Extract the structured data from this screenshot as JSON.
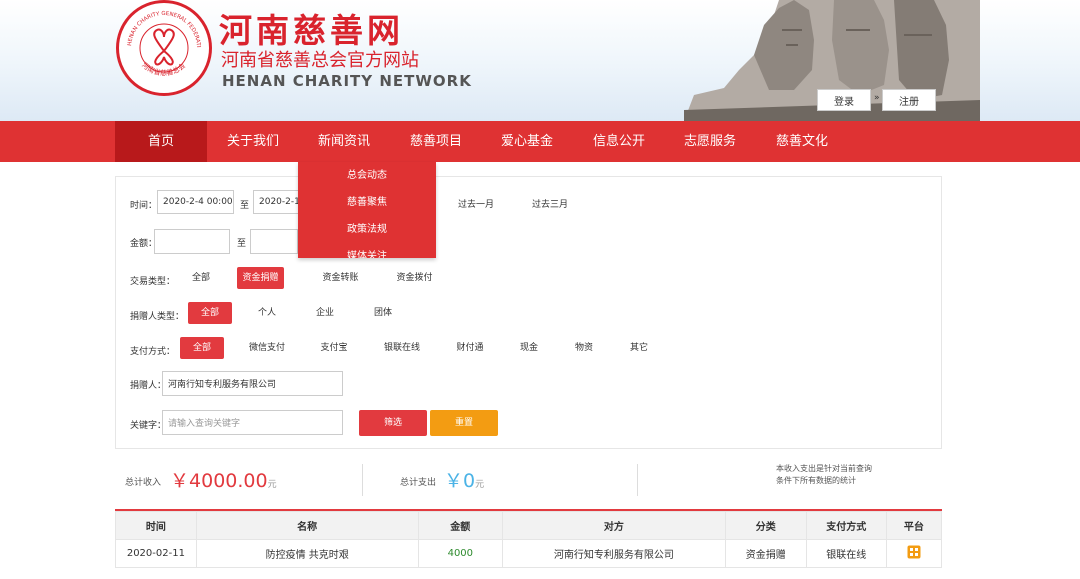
{
  "site": {
    "title": "河南慈善网",
    "subtitle": "河南省慈善总会官方网站",
    "english": "HENAN CHARITY NETWORK",
    "seal_text_top": "HENAN CHARITY GENERAL FEDERATION",
    "seal_text_bottom": "河南省慈善总会"
  },
  "auth": {
    "login": "登录",
    "separator": "»",
    "register": "注册"
  },
  "nav": [
    "首页",
    "关于我们",
    "新闻资讯",
    "慈善项目",
    "爱心基金",
    "信息公开",
    "志愿服务",
    "慈善文化"
  ],
  "dropdown": [
    "总会动态",
    "慈善聚焦",
    "政策法规",
    "媒体关注"
  ],
  "filters": {
    "time_label": "时间：",
    "time_from": "2020-2-4 00:00:0",
    "to": "至",
    "time_to": "2020-2-11",
    "quick": [
      "过去一月",
      "过去三月"
    ],
    "amount_label": "金额：",
    "trade_label": "交易类型：",
    "trade_options": [
      "全部",
      "资金捐赠",
      "资金转账",
      "资金拨付"
    ],
    "trade_selected": 1,
    "donor_type_label": "捐赠人类型：",
    "donor_type_options": [
      "全部",
      "个人",
      "企业",
      "团体"
    ],
    "donor_type_selected": 0,
    "pay_label": "支付方式：",
    "pay_options": [
      "全部",
      "微信支付",
      "支付宝",
      "银联在线",
      "财付通",
      "现金",
      "物资",
      "其它"
    ],
    "pay_selected": 0,
    "donor_label": "捐赠人：",
    "donor_value": "河南行知专利服务有限公司",
    "keyword_label": "关键字：",
    "keyword_placeholder": "请输入查询关键字",
    "filter_btn": "筛选",
    "reset_btn": "重置"
  },
  "summary": {
    "income_label": "总计收入",
    "income_symbol": "￥",
    "income_value": "4000.00",
    "income_unit": "元",
    "expense_label": "总计支出",
    "expense_symbol": "￥",
    "expense_value": "0",
    "expense_unit": "元",
    "note_line1": "本收入支出是针对当前查询",
    "note_line2": "条件下所有数据的统计"
  },
  "table": {
    "headers": [
      "时间",
      "名称",
      "金额",
      "对方",
      "分类",
      "支付方式",
      "平台"
    ],
    "rows": [
      [
        "2020-02-11",
        "防控疫情 共克时艰",
        "4000",
        "河南行知专利服务有限公司",
        "资金捐赠",
        "银联在线",
        ""
      ]
    ]
  },
  "colors": {
    "brand_red": "#df3233",
    "accent_orange": "#f39c12",
    "amount_green": "#2e8b2e",
    "expense_blue": "#4bb3e6"
  }
}
